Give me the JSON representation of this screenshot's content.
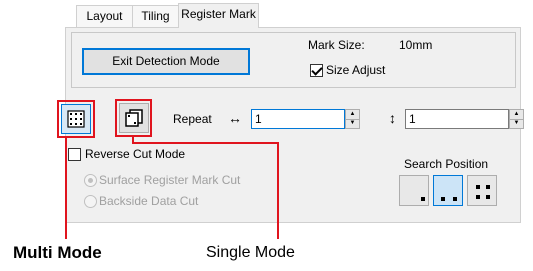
{
  "tabs": [
    {
      "label": "Layout"
    },
    {
      "label": "Tiling"
    },
    {
      "label": "Register Mark",
      "active": true
    }
  ],
  "exit_button": {
    "label": "Exit Detection Mode"
  },
  "mark_size": {
    "label": "Mark Size:",
    "value": "10mm"
  },
  "size_adjust": {
    "label": "Size Adjust",
    "checked": true
  },
  "repeat": {
    "label": "Repeat",
    "horizontal_symbol": "↔",
    "horizontal_value": "1",
    "vertical_symbol": "↕",
    "vertical_value": "1"
  },
  "reverse_cut": {
    "label": "Reverse Cut Mode",
    "checked": false
  },
  "cut_options": [
    {
      "label": "Surface Register Mark Cut",
      "selected": true,
      "enabled": false
    },
    {
      "label": "Backside Data Cut",
      "selected": false,
      "enabled": false
    }
  ],
  "search_position": {
    "label": "Search Position",
    "options": [
      "one",
      "two",
      "four"
    ],
    "selected": "two"
  },
  "callouts": {
    "multi_mode": "Multi Mode",
    "single_mode": "Single Mode"
  },
  "colors": {
    "callout": "#e0141e",
    "focus": "#0078d7",
    "panel": "#f0f0f0"
  }
}
